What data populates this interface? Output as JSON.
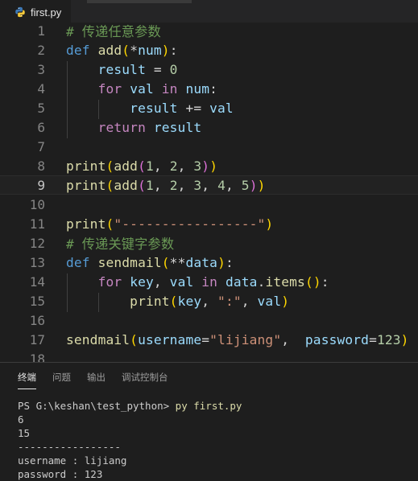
{
  "tab": {
    "filename": "first.py",
    "icon": "python-icon"
  },
  "editor": {
    "current_line": 9,
    "lines": [
      {
        "n": "1",
        "tokens": [
          {
            "t": "# 传递任意参数",
            "c": "cm"
          }
        ]
      },
      {
        "n": "2",
        "tokens": [
          {
            "t": "def",
            "c": "kw"
          },
          {
            "t": " ",
            "c": "op"
          },
          {
            "t": "add",
            "c": "fn"
          },
          {
            "t": "(",
            "c": "b1"
          },
          {
            "t": "*",
            "c": "op"
          },
          {
            "t": "num",
            "c": "vr"
          },
          {
            "t": ")",
            "c": "b1"
          },
          {
            "t": ":",
            "c": "op"
          }
        ]
      },
      {
        "n": "3",
        "tokens": [
          {
            "t": "    ",
            "c": "op"
          },
          {
            "t": "result",
            "c": "vr"
          },
          {
            "t": " = ",
            "c": "op"
          },
          {
            "t": "0",
            "c": "nm"
          }
        ]
      },
      {
        "n": "4",
        "tokens": [
          {
            "t": "    ",
            "c": "op"
          },
          {
            "t": "for",
            "c": "ctl"
          },
          {
            "t": " ",
            "c": "op"
          },
          {
            "t": "val",
            "c": "vr"
          },
          {
            "t": " ",
            "c": "op"
          },
          {
            "t": "in",
            "c": "ctl"
          },
          {
            "t": " ",
            "c": "op"
          },
          {
            "t": "num",
            "c": "vr"
          },
          {
            "t": ":",
            "c": "op"
          }
        ]
      },
      {
        "n": "5",
        "tokens": [
          {
            "t": "        ",
            "c": "op"
          },
          {
            "t": "result",
            "c": "vr"
          },
          {
            "t": " += ",
            "c": "op"
          },
          {
            "t": "val",
            "c": "vr"
          }
        ]
      },
      {
        "n": "6",
        "tokens": [
          {
            "t": "    ",
            "c": "op"
          },
          {
            "t": "return",
            "c": "ctl"
          },
          {
            "t": " ",
            "c": "op"
          },
          {
            "t": "result",
            "c": "vr"
          }
        ]
      },
      {
        "n": "7",
        "tokens": []
      },
      {
        "n": "8",
        "tokens": [
          {
            "t": "print",
            "c": "fn"
          },
          {
            "t": "(",
            "c": "b1"
          },
          {
            "t": "add",
            "c": "fn"
          },
          {
            "t": "(",
            "c": "b2"
          },
          {
            "t": "1",
            "c": "nm"
          },
          {
            "t": ", ",
            "c": "op"
          },
          {
            "t": "2",
            "c": "nm"
          },
          {
            "t": ", ",
            "c": "op"
          },
          {
            "t": "3",
            "c": "nm"
          },
          {
            "t": ")",
            "c": "b2"
          },
          {
            "t": ")",
            "c": "b1"
          }
        ]
      },
      {
        "n": "9",
        "tokens": [
          {
            "t": "print",
            "c": "fn"
          },
          {
            "t": "(",
            "c": "b1"
          },
          {
            "t": "add",
            "c": "fn"
          },
          {
            "t": "(",
            "c": "b2"
          },
          {
            "t": "1",
            "c": "nm"
          },
          {
            "t": ", ",
            "c": "op"
          },
          {
            "t": "2",
            "c": "nm"
          },
          {
            "t": ", ",
            "c": "op"
          },
          {
            "t": "3",
            "c": "nm"
          },
          {
            "t": ", ",
            "c": "op"
          },
          {
            "t": "4",
            "c": "nm"
          },
          {
            "t": ", ",
            "c": "op"
          },
          {
            "t": "5",
            "c": "nm"
          },
          {
            "t": ")",
            "c": "b2"
          },
          {
            "t": ")",
            "c": "b1"
          }
        ]
      },
      {
        "n": "10",
        "tokens": []
      },
      {
        "n": "11",
        "tokens": [
          {
            "t": "print",
            "c": "fn"
          },
          {
            "t": "(",
            "c": "b1"
          },
          {
            "t": "\"-----------------\"",
            "c": "st"
          },
          {
            "t": ")",
            "c": "b1"
          }
        ]
      },
      {
        "n": "12",
        "tokens": [
          {
            "t": "# 传递关键字参数",
            "c": "cm"
          }
        ]
      },
      {
        "n": "13",
        "tokens": [
          {
            "t": "def",
            "c": "kw"
          },
          {
            "t": " ",
            "c": "op"
          },
          {
            "t": "sendmail",
            "c": "fn"
          },
          {
            "t": "(",
            "c": "b1"
          },
          {
            "t": "**",
            "c": "op"
          },
          {
            "t": "data",
            "c": "vr"
          },
          {
            "t": ")",
            "c": "b1"
          },
          {
            "t": ":",
            "c": "op"
          }
        ]
      },
      {
        "n": "14",
        "tokens": [
          {
            "t": "    ",
            "c": "op"
          },
          {
            "t": "for",
            "c": "ctl"
          },
          {
            "t": " ",
            "c": "op"
          },
          {
            "t": "key",
            "c": "vr"
          },
          {
            "t": ", ",
            "c": "op"
          },
          {
            "t": "val",
            "c": "vr"
          },
          {
            "t": " ",
            "c": "op"
          },
          {
            "t": "in",
            "c": "ctl"
          },
          {
            "t": " ",
            "c": "op"
          },
          {
            "t": "data",
            "c": "vr"
          },
          {
            "t": ".",
            "c": "op"
          },
          {
            "t": "items",
            "c": "fn"
          },
          {
            "t": "(",
            "c": "b1"
          },
          {
            "t": ")",
            "c": "b1"
          },
          {
            "t": ":",
            "c": "op"
          }
        ]
      },
      {
        "n": "15",
        "tokens": [
          {
            "t": "        ",
            "c": "op"
          },
          {
            "t": "print",
            "c": "fn"
          },
          {
            "t": "(",
            "c": "b1"
          },
          {
            "t": "key",
            "c": "vr"
          },
          {
            "t": ", ",
            "c": "op"
          },
          {
            "t": "\":\"",
            "c": "st"
          },
          {
            "t": ", ",
            "c": "op"
          },
          {
            "t": "val",
            "c": "vr"
          },
          {
            "t": ")",
            "c": "b1"
          }
        ]
      },
      {
        "n": "16",
        "tokens": []
      },
      {
        "n": "17",
        "tokens": [
          {
            "t": "sendmail",
            "c": "fn"
          },
          {
            "t": "(",
            "c": "b1"
          },
          {
            "t": "username",
            "c": "vr"
          },
          {
            "t": "=",
            "c": "op"
          },
          {
            "t": "\"lijiang\"",
            "c": "st"
          },
          {
            "t": ",  ",
            "c": "op"
          },
          {
            "t": "password",
            "c": "vr"
          },
          {
            "t": "=",
            "c": "op"
          },
          {
            "t": "123",
            "c": "nm"
          },
          {
            "t": ")",
            "c": "b1"
          }
        ]
      },
      {
        "n": "18",
        "tokens": []
      }
    ]
  },
  "panel": {
    "tabs": [
      {
        "label": "终端",
        "active": true
      },
      {
        "label": "问题",
        "active": false
      },
      {
        "label": "输出",
        "active": false
      },
      {
        "label": "调试控制台",
        "active": false
      }
    ],
    "terminal": {
      "prompt": "PS G:\\keshan\\test_python> ",
      "command": "py first.py",
      "output": [
        "6",
        "15",
        "-----------------",
        "username : lijiang",
        "password : 123"
      ]
    }
  }
}
